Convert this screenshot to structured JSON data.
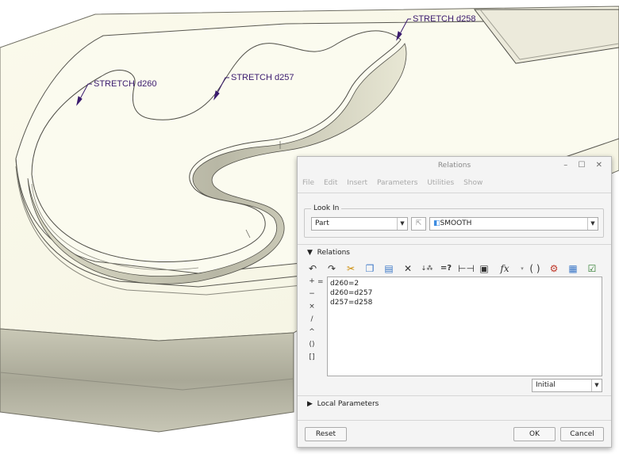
{
  "viewport": {
    "dimensions": [
      {
        "label": "STRETCH d258"
      },
      {
        "label": "STRETCH d257"
      },
      {
        "label": "STRETCH d260"
      }
    ]
  },
  "dialog": {
    "title": "Relations",
    "window_buttons": "– ☐ ✕",
    "menu": [
      "File",
      "Edit",
      "Insert",
      "Parameters",
      "Utilities",
      "Show"
    ],
    "look_in": {
      "legend": "Look In",
      "type_value": "Part",
      "model_value": "SMOOTH"
    },
    "relations": {
      "heading": "Relations",
      "toolbar_icons": [
        "undo-icon",
        "redo-icon",
        "cut-icon",
        "copy-icon",
        "paste-icon",
        "delete-icon",
        "sort-icon",
        "evaluate-icon",
        "measure-icon",
        "show-values-icon",
        "function-icon",
        "brackets-icon",
        "parameters-icon",
        "display-icon",
        "verify-icon"
      ],
      "operators": [
        "+",
        "=",
        "−",
        "×",
        "/",
        "^",
        "()",
        "[]"
      ],
      "lines": [
        "d260=2",
        "d260=d257",
        "d257=d258"
      ],
      "initial_value": "Initial"
    },
    "local_parameters": "Local Parameters",
    "buttons": {
      "reset": "Reset",
      "ok": "OK",
      "cancel": "Cancel"
    }
  }
}
